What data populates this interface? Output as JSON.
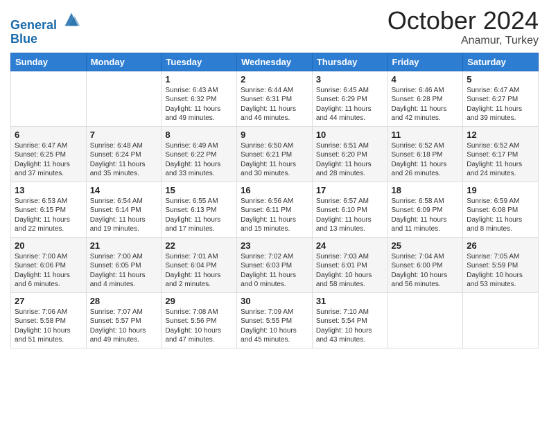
{
  "header": {
    "logo_line1": "General",
    "logo_line2": "Blue",
    "month": "October 2024",
    "location": "Anamur, Turkey"
  },
  "days_of_week": [
    "Sunday",
    "Monday",
    "Tuesday",
    "Wednesday",
    "Thursday",
    "Friday",
    "Saturday"
  ],
  "weeks": [
    [
      {
        "day": "",
        "info": ""
      },
      {
        "day": "",
        "info": ""
      },
      {
        "day": "1",
        "info": "Sunrise: 6:43 AM\nSunset: 6:32 PM\nDaylight: 11 hours and 49 minutes."
      },
      {
        "day": "2",
        "info": "Sunrise: 6:44 AM\nSunset: 6:31 PM\nDaylight: 11 hours and 46 minutes."
      },
      {
        "day": "3",
        "info": "Sunrise: 6:45 AM\nSunset: 6:29 PM\nDaylight: 11 hours and 44 minutes."
      },
      {
        "day": "4",
        "info": "Sunrise: 6:46 AM\nSunset: 6:28 PM\nDaylight: 11 hours and 42 minutes."
      },
      {
        "day": "5",
        "info": "Sunrise: 6:47 AM\nSunset: 6:27 PM\nDaylight: 11 hours and 39 minutes."
      }
    ],
    [
      {
        "day": "6",
        "info": "Sunrise: 6:47 AM\nSunset: 6:25 PM\nDaylight: 11 hours and 37 minutes."
      },
      {
        "day": "7",
        "info": "Sunrise: 6:48 AM\nSunset: 6:24 PM\nDaylight: 11 hours and 35 minutes."
      },
      {
        "day": "8",
        "info": "Sunrise: 6:49 AM\nSunset: 6:22 PM\nDaylight: 11 hours and 33 minutes."
      },
      {
        "day": "9",
        "info": "Sunrise: 6:50 AM\nSunset: 6:21 PM\nDaylight: 11 hours and 30 minutes."
      },
      {
        "day": "10",
        "info": "Sunrise: 6:51 AM\nSunset: 6:20 PM\nDaylight: 11 hours and 28 minutes."
      },
      {
        "day": "11",
        "info": "Sunrise: 6:52 AM\nSunset: 6:18 PM\nDaylight: 11 hours and 26 minutes."
      },
      {
        "day": "12",
        "info": "Sunrise: 6:52 AM\nSunset: 6:17 PM\nDaylight: 11 hours and 24 minutes."
      }
    ],
    [
      {
        "day": "13",
        "info": "Sunrise: 6:53 AM\nSunset: 6:15 PM\nDaylight: 11 hours and 22 minutes."
      },
      {
        "day": "14",
        "info": "Sunrise: 6:54 AM\nSunset: 6:14 PM\nDaylight: 11 hours and 19 minutes."
      },
      {
        "day": "15",
        "info": "Sunrise: 6:55 AM\nSunset: 6:13 PM\nDaylight: 11 hours and 17 minutes."
      },
      {
        "day": "16",
        "info": "Sunrise: 6:56 AM\nSunset: 6:11 PM\nDaylight: 11 hours and 15 minutes."
      },
      {
        "day": "17",
        "info": "Sunrise: 6:57 AM\nSunset: 6:10 PM\nDaylight: 11 hours and 13 minutes."
      },
      {
        "day": "18",
        "info": "Sunrise: 6:58 AM\nSunset: 6:09 PM\nDaylight: 11 hours and 11 minutes."
      },
      {
        "day": "19",
        "info": "Sunrise: 6:59 AM\nSunset: 6:08 PM\nDaylight: 11 hours and 8 minutes."
      }
    ],
    [
      {
        "day": "20",
        "info": "Sunrise: 7:00 AM\nSunset: 6:06 PM\nDaylight: 11 hours and 6 minutes."
      },
      {
        "day": "21",
        "info": "Sunrise: 7:00 AM\nSunset: 6:05 PM\nDaylight: 11 hours and 4 minutes."
      },
      {
        "day": "22",
        "info": "Sunrise: 7:01 AM\nSunset: 6:04 PM\nDaylight: 11 hours and 2 minutes."
      },
      {
        "day": "23",
        "info": "Sunrise: 7:02 AM\nSunset: 6:03 PM\nDaylight: 11 hours and 0 minutes."
      },
      {
        "day": "24",
        "info": "Sunrise: 7:03 AM\nSunset: 6:01 PM\nDaylight: 10 hours and 58 minutes."
      },
      {
        "day": "25",
        "info": "Sunrise: 7:04 AM\nSunset: 6:00 PM\nDaylight: 10 hours and 56 minutes."
      },
      {
        "day": "26",
        "info": "Sunrise: 7:05 AM\nSunset: 5:59 PM\nDaylight: 10 hours and 53 minutes."
      }
    ],
    [
      {
        "day": "27",
        "info": "Sunrise: 7:06 AM\nSunset: 5:58 PM\nDaylight: 10 hours and 51 minutes."
      },
      {
        "day": "28",
        "info": "Sunrise: 7:07 AM\nSunset: 5:57 PM\nDaylight: 10 hours and 49 minutes."
      },
      {
        "day": "29",
        "info": "Sunrise: 7:08 AM\nSunset: 5:56 PM\nDaylight: 10 hours and 47 minutes."
      },
      {
        "day": "30",
        "info": "Sunrise: 7:09 AM\nSunset: 5:55 PM\nDaylight: 10 hours and 45 minutes."
      },
      {
        "day": "31",
        "info": "Sunrise: 7:10 AM\nSunset: 5:54 PM\nDaylight: 10 hours and 43 minutes."
      },
      {
        "day": "",
        "info": ""
      },
      {
        "day": "",
        "info": ""
      }
    ]
  ]
}
